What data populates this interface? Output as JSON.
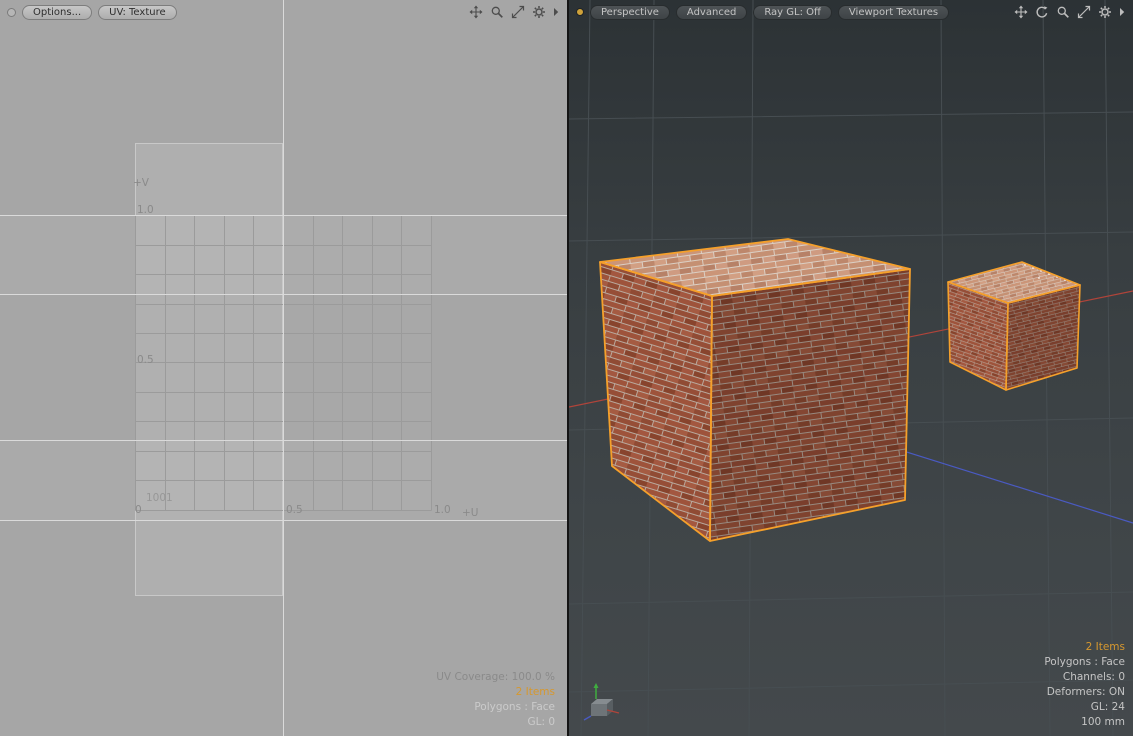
{
  "colors": {
    "selection_orange": "#f5a02b",
    "items_orange": "#d6982f",
    "axis_red": "#b0443a",
    "axis_blue": "#4a5ac2"
  },
  "uv_panel": {
    "header": {
      "options_button": "Options...",
      "uv_map_button": "UV: Texture"
    },
    "grid": {
      "v_axis_label": "+V",
      "u_axis_label": "+U",
      "v_max": "1.0",
      "v_mid": "0.5",
      "origin": "0",
      "u_mid": "0.5",
      "u_max": "1.0",
      "udim_tile": "1001"
    },
    "status": {
      "uv_coverage": "UV Coverage: 100.0 %",
      "items": "2 Items",
      "polygons": "Polygons : Face",
      "gl": "GL: 0"
    }
  },
  "viewport_3d": {
    "header": {
      "view_mode_button": "Perspective",
      "shading_button": "Advanced",
      "ray_gl_button": "Ray GL: Off",
      "textures_button": "Viewport Textures"
    },
    "status": {
      "items": "2 Items",
      "polygons": "Polygons : Face",
      "channels": "Channels: 0",
      "deformers": "Deformers: ON",
      "gl": "GL: 24",
      "grid_size": "100 mm"
    }
  }
}
